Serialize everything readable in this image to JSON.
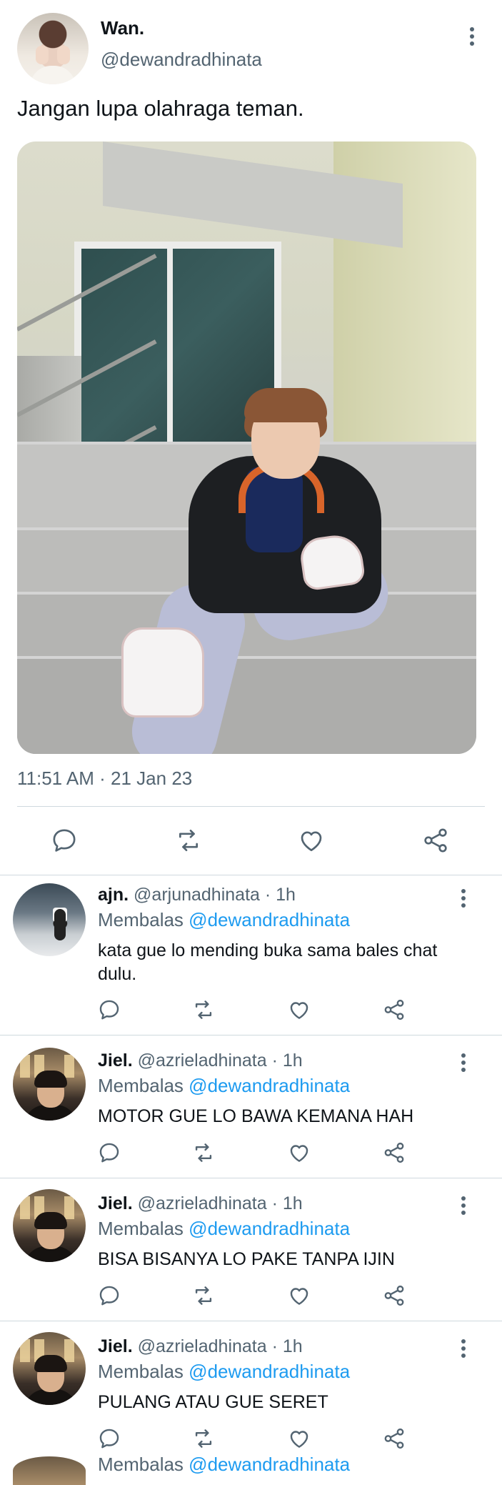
{
  "main_tweet": {
    "display_name": "Wan.",
    "handle": "@dewandradhinata",
    "text": "Jangan lupa olahraga teman.",
    "timestamp": "11:51 AM · 21 Jan 23",
    "icons": [
      "reply-icon",
      "retweet-icon",
      "like-icon",
      "share-icon",
      "more-icon"
    ]
  },
  "replies": [
    {
      "display_name": "ajn.",
      "meta": "@arjunadhinata · 1h",
      "reply_prefix": "Membalas",
      "reply_mention": "@dewandradhinata",
      "text": "kata gue lo mending buka sama bales chat dulu."
    },
    {
      "display_name": "Jiel.",
      "meta": "@azrieladhinata · 1h",
      "reply_prefix": "Membalas",
      "reply_mention": "@dewandradhinata",
      "text": "MOTOR GUE LO BAWA KEMANA HAH"
    },
    {
      "display_name": "Jiel.",
      "meta": "@azrieladhinata · 1h",
      "reply_prefix": "Membalas",
      "reply_mention": "@dewandradhinata",
      "text": "BISA BISANYA LO PAKE TANPA IJIN"
    },
    {
      "display_name": "Jiel.",
      "meta": "@azrieladhinata · 1h",
      "reply_prefix": "Membalas",
      "reply_mention": "@dewandradhinata",
      "text": "PULANG ATAU GUE SERET"
    }
  ],
  "peek": {
    "reply_prefix": "Membalas",
    "reply_mention": "@dewandradhinata"
  },
  "colors": {
    "text_primary": "#0f1419",
    "text_secondary": "#536471",
    "mention": "#1d9bf0",
    "divider": "#cfd9de"
  }
}
